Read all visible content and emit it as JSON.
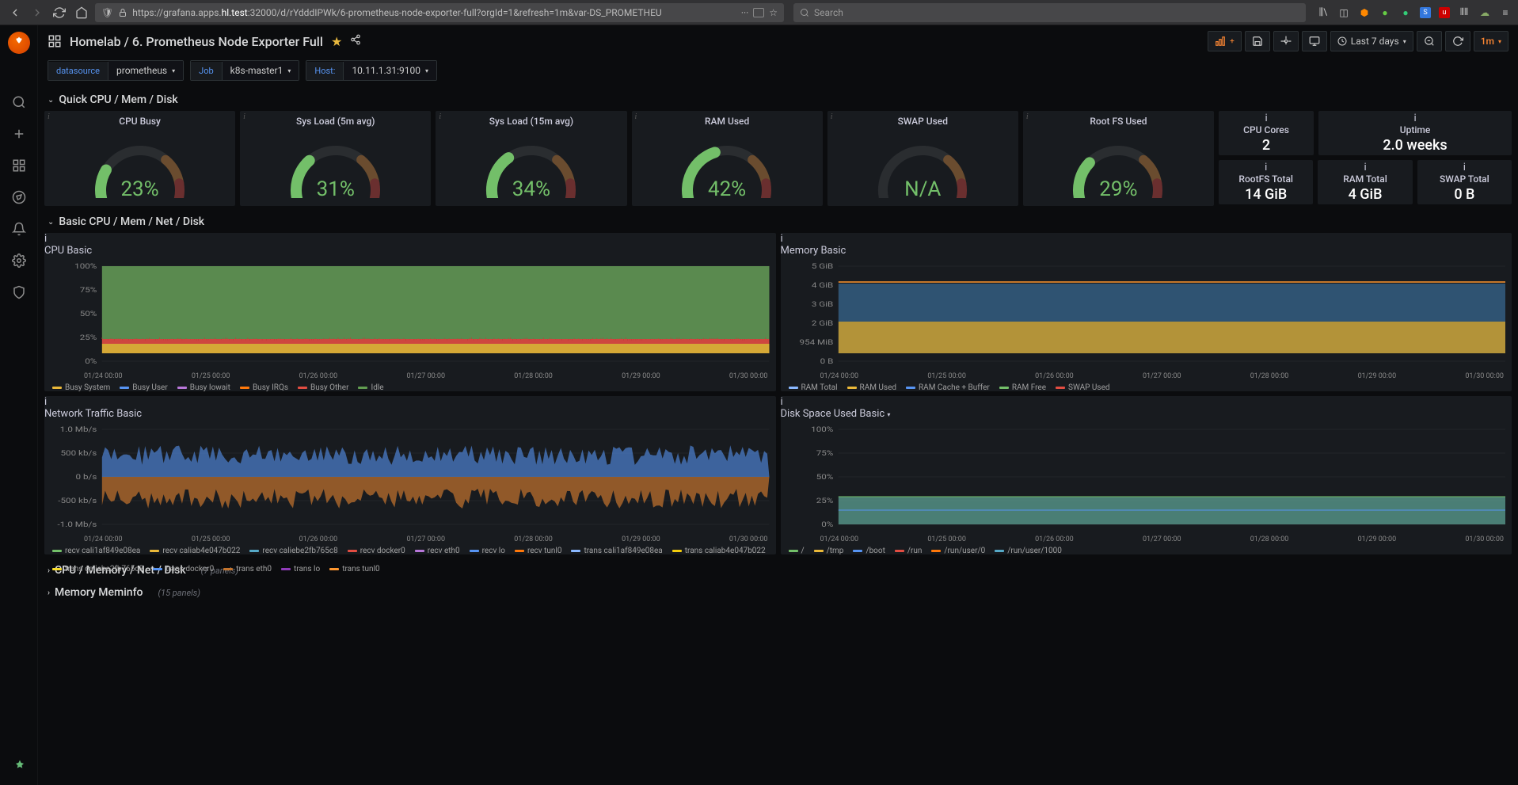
{
  "browser": {
    "url_prefix": "https://grafana.apps.",
    "url_host": "hl.test",
    "url_suffix": ":32000/d/rYdddIPWk/6-prometheus-node-exporter-full?orgId=1&refresh=1m&var-DS_PROMETHEU",
    "search_placeholder": "Search"
  },
  "breadcrumb": {
    "folder": "Homelab",
    "dashboard": "6. Prometheus Node Exporter Full"
  },
  "toolbar": {
    "time_range": "Last 7 days",
    "refresh_interval": "1m"
  },
  "vars": {
    "datasource": {
      "label": "datasource",
      "value": "prometheus"
    },
    "job": {
      "label": "Job",
      "value": "k8s-master1"
    },
    "host": {
      "label": "Host:",
      "value": "10.11.1.31:9100"
    }
  },
  "rows": {
    "quick": "Quick CPU / Mem / Disk",
    "basic": "Basic CPU / Mem / Net / Disk",
    "cpumem": "CPU / Memory / Net / Disk",
    "cpumem_count": "(7 panels)",
    "meminfo": "Memory Meminfo",
    "meminfo_count": "(15 panels)"
  },
  "gauges": [
    {
      "title": "CPU Busy",
      "value": "23%",
      "pct": 23
    },
    {
      "title": "Sys Load (5m avg)",
      "value": "31%",
      "pct": 31
    },
    {
      "title": "Sys Load (15m avg)",
      "value": "34%",
      "pct": 34
    },
    {
      "title": "RAM Used",
      "value": "42%",
      "pct": 42
    },
    {
      "title": "SWAP Used",
      "value": "N/A",
      "pct": 0
    },
    {
      "title": "Root FS Used",
      "value": "29%",
      "pct": 29
    }
  ],
  "stats": {
    "cpu_cores": {
      "title": "CPU Cores",
      "value": "2"
    },
    "uptime": {
      "title": "Uptime",
      "value": "2.0 weeks"
    },
    "rootfs": {
      "title": "RootFS Total",
      "value": "14 GiB"
    },
    "ram": {
      "title": "RAM Total",
      "value": "4 GiB"
    },
    "swap": {
      "title": "SWAP Total",
      "value": "0 B"
    }
  },
  "xaxis": [
    "01/24 00:00",
    "01/25 00:00",
    "01/26 00:00",
    "01/27 00:00",
    "01/28 00:00",
    "01/29 00:00",
    "01/30 00:00"
  ],
  "cpu_basic": {
    "title": "CPU Basic",
    "y": [
      "100%",
      "75%",
      "50%",
      "25%",
      "0%"
    ],
    "legend": [
      {
        "name": "Busy System",
        "color": "#eab839"
      },
      {
        "name": "Busy User",
        "color": "#5794f2"
      },
      {
        "name": "Busy Iowait",
        "color": "#b877d9"
      },
      {
        "name": "Busy IRQs",
        "color": "#ff780a"
      },
      {
        "name": "Busy Other",
        "color": "#e24d42"
      },
      {
        "name": "Idle",
        "color": "#629e51"
      }
    ]
  },
  "mem_basic": {
    "title": "Memory Basic",
    "y": [
      "5 GiB",
      "4 GiB",
      "3 GiB",
      "2 GiB",
      "954 MiB",
      "0 B"
    ],
    "legend": [
      {
        "name": "RAM Total",
        "color": "#8ab8ff"
      },
      {
        "name": "RAM Used",
        "color": "#eab839"
      },
      {
        "name": "RAM Cache + Buffer",
        "color": "#5794f2"
      },
      {
        "name": "RAM Free",
        "color": "#73bf69"
      },
      {
        "name": "SWAP Used",
        "color": "#e24d42"
      }
    ]
  },
  "net_basic": {
    "title": "Network Traffic Basic",
    "y": [
      "1.0 Mb/s",
      "500 kb/s",
      "0 b/s",
      "-500 kb/s",
      "-1.0 Mb/s"
    ],
    "legend1": [
      {
        "name": "recv cali1af849e08ea",
        "color": "#73bf69"
      },
      {
        "name": "recv caliab4e047b022",
        "color": "#eab839"
      },
      {
        "name": "recv caliebe2fb765c8",
        "color": "#56a9c7"
      },
      {
        "name": "recv docker0",
        "color": "#e24d42"
      },
      {
        "name": "recv eth0",
        "color": "#b877d9"
      },
      {
        "name": "recv lo",
        "color": "#5794f2"
      },
      {
        "name": "recv tunl0",
        "color": "#ff780a"
      }
    ],
    "legend2": [
      {
        "name": "trans cali1af849e08ea",
        "color": "#8ab8ff"
      },
      {
        "name": "trans caliab4e047b022",
        "color": "#f2cc0c"
      },
      {
        "name": "trans caliebe2fb765c8",
        "color": "#fade2a"
      },
      {
        "name": "trans docker0",
        "color": "#5794f2"
      },
      {
        "name": "trans eth0",
        "color": "#c4742d"
      },
      {
        "name": "trans lo",
        "color": "#8f3bb8"
      },
      {
        "name": "trans tunl0",
        "color": "#ff9830"
      }
    ]
  },
  "disk_basic": {
    "title": "Disk Space Used Basic",
    "y": [
      "100%",
      "75%",
      "50%",
      "25%",
      "0%"
    ],
    "legend": [
      {
        "name": "/",
        "color": "#73bf69"
      },
      {
        "name": "/tmp",
        "color": "#eab839"
      },
      {
        "name": "/boot",
        "color": "#5794f2"
      },
      {
        "name": "/run",
        "color": "#e24d42"
      },
      {
        "name": "/run/user/0",
        "color": "#ff780a"
      },
      {
        "name": "/run/user/1000",
        "color": "#56a9c7"
      }
    ]
  },
  "chart_data": [
    {
      "type": "gauge",
      "title": "CPU Busy",
      "value": 23,
      "unit": "%",
      "range": [
        0,
        100
      ]
    },
    {
      "type": "gauge",
      "title": "Sys Load (5m avg)",
      "value": 31,
      "unit": "%",
      "range": [
        0,
        100
      ]
    },
    {
      "type": "gauge",
      "title": "Sys Load (15m avg)",
      "value": 34,
      "unit": "%",
      "range": [
        0,
        100
      ]
    },
    {
      "type": "gauge",
      "title": "RAM Used",
      "value": 42,
      "unit": "%",
      "range": [
        0,
        100
      ]
    },
    {
      "type": "gauge",
      "title": "SWAP Used",
      "value": null,
      "unit": "%",
      "range": [
        0,
        100
      ]
    },
    {
      "type": "gauge",
      "title": "Root FS Used",
      "value": 29,
      "unit": "%",
      "range": [
        0,
        100
      ]
    },
    {
      "type": "area",
      "title": "CPU Basic",
      "x": [
        "01/24 00:00",
        "01/25 00:00",
        "01/26 00:00",
        "01/27 00:00",
        "01/28 00:00",
        "01/29 00:00",
        "01/30 00:00"
      ],
      "ylim": [
        0,
        100
      ],
      "yunit": "%",
      "stacked": true,
      "series": [
        {
          "name": "Busy System",
          "values": [
            5,
            5,
            5,
            5,
            5,
            5,
            5
          ]
        },
        {
          "name": "Busy User",
          "values": [
            5,
            5,
            5,
            5,
            5,
            5,
            5
          ]
        },
        {
          "name": "Busy Iowait",
          "values": [
            2,
            2,
            2,
            2,
            2,
            2,
            2
          ]
        },
        {
          "name": "Busy IRQs",
          "values": [
            3,
            3,
            3,
            3,
            3,
            3,
            3
          ]
        },
        {
          "name": "Busy Other",
          "values": [
            8,
            8,
            8,
            8,
            8,
            8,
            8
          ]
        },
        {
          "name": "Idle",
          "values": [
            77,
            77,
            77,
            77,
            77,
            77,
            77
          ]
        }
      ]
    },
    {
      "type": "area",
      "title": "Memory Basic",
      "x": [
        "01/24 00:00",
        "01/25 00:00",
        "01/26 00:00",
        "01/27 00:00",
        "01/28 00:00",
        "01/29 00:00",
        "01/30 00:00"
      ],
      "ylim": [
        0,
        5
      ],
      "yunit": "GiB",
      "stacked": true,
      "series": [
        {
          "name": "RAM Total",
          "values": [
            4.1,
            4.1,
            4.1,
            4.1,
            4.1,
            4.1,
            4.1
          ]
        },
        {
          "name": "RAM Used",
          "values": [
            1.7,
            1.7,
            1.7,
            1.7,
            1.7,
            1.7,
            1.7
          ]
        },
        {
          "name": "RAM Cache + Buffer",
          "values": [
            2.2,
            2.2,
            2.2,
            2.2,
            2.2,
            2.2,
            2.2
          ]
        },
        {
          "name": "RAM Free",
          "values": [
            0.15,
            0.15,
            0.15,
            0.15,
            0.15,
            0.15,
            0.15
          ]
        },
        {
          "name": "SWAP Used",
          "values": [
            0,
            0,
            0,
            0,
            0,
            0,
            0
          ]
        }
      ]
    },
    {
      "type": "line",
      "title": "Network Traffic Basic",
      "x": [
        "01/24 00:00",
        "01/25 00:00",
        "01/26 00:00",
        "01/27 00:00",
        "01/28 00:00",
        "01/29 00:00",
        "01/30 00:00"
      ],
      "ylim": [
        -1.0,
        1.0
      ],
      "yunit": "Mb/s",
      "series": [
        {
          "name": "recv eth0",
          "values": [
            0.35,
            0.35,
            0.35,
            0.35,
            0.35,
            0.35,
            0.35
          ]
        },
        {
          "name": "trans eth0",
          "values": [
            -0.35,
            -0.35,
            -0.35,
            -0.35,
            -0.35,
            -0.35,
            -0.35
          ]
        }
      ]
    },
    {
      "type": "area",
      "title": "Disk Space Used Basic",
      "x": [
        "01/24 00:00",
        "01/25 00:00",
        "01/26 00:00",
        "01/27 00:00",
        "01/28 00:00",
        "01/29 00:00",
        "01/30 00:00"
      ],
      "ylim": [
        0,
        100
      ],
      "yunit": "%",
      "stacked": false,
      "series": [
        {
          "name": "/",
          "values": [
            29,
            29,
            29,
            29,
            29,
            29,
            29
          ]
        },
        {
          "name": "/boot",
          "values": [
            15,
            15,
            15,
            15,
            15,
            15,
            15
          ]
        },
        {
          "name": "/tmp",
          "values": [
            2,
            2,
            2,
            2,
            2,
            2,
            2
          ]
        },
        {
          "name": "/run",
          "values": [
            2,
            2,
            2,
            2,
            2,
            2,
            2
          ]
        },
        {
          "name": "/run/user/0",
          "values": [
            0,
            0,
            0,
            0,
            0,
            0,
            0
          ]
        },
        {
          "name": "/run/user/1000",
          "values": [
            0,
            0,
            0,
            0,
            0,
            0,
            0
          ]
        }
      ]
    }
  ]
}
